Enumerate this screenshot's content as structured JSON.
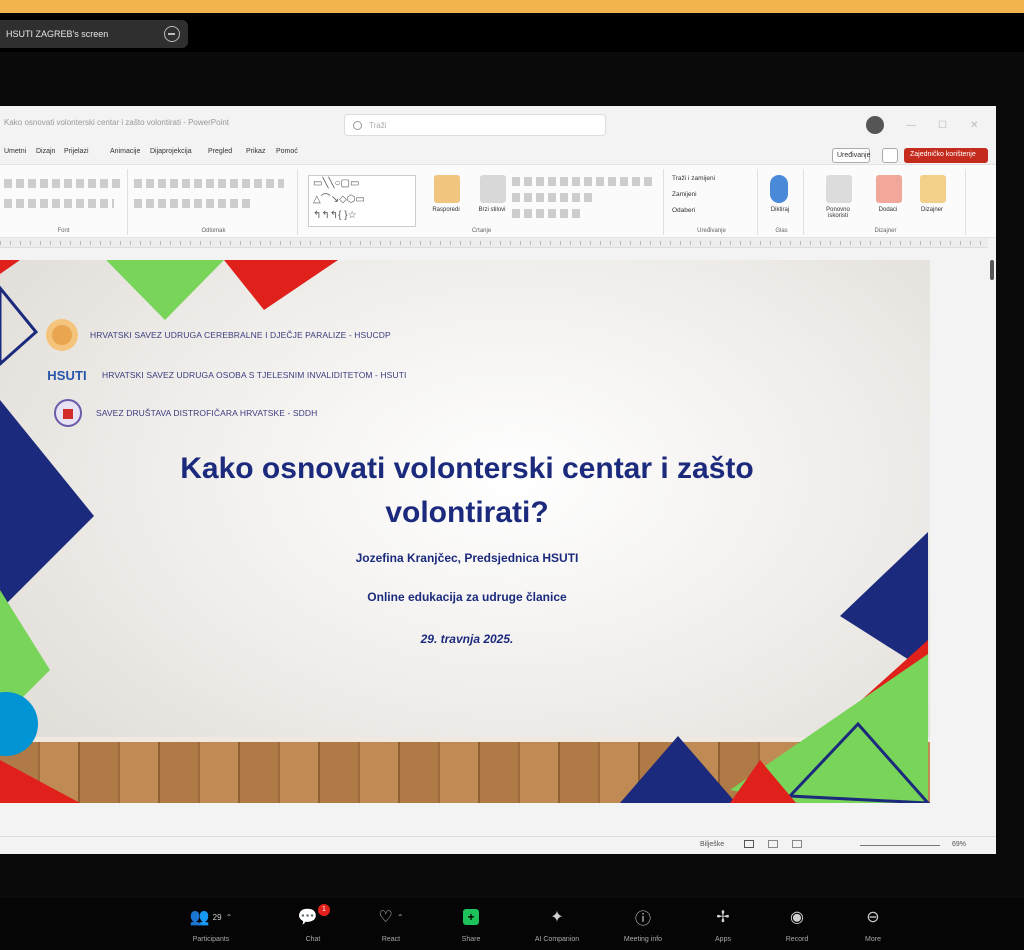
{
  "banner_color": "#f2b54d",
  "share_indicator": {
    "label": "HSUTI ZAGREB's screen",
    "icon": "minus-circle-icon"
  },
  "ppt": {
    "window_title": "Kako osnovati volonterski centar i zašto volontirati - PowerPoint",
    "search_placeholder": "Traži",
    "menu": [
      "Umetni",
      "Dizajn",
      "Prijelazi",
      "Animacije",
      "Dijaprojekcija",
      "Pregled",
      "Prikaz",
      "Pomoć"
    ],
    "editing_label": "Uređivanje",
    "share_label": "Zajedničko korištenje",
    "ribbon_groups": [
      "Font",
      "Odlomak",
      "Crtanje",
      "Uređivanje",
      "Glas",
      "Dizajner"
    ],
    "ribbon_buttons": {
      "arrange": "Rasporedi",
      "quick_styles": "Brzi stilovi",
      "find": "Traži i zamijeni",
      "replace": "Zamijeni",
      "select": "Odaberi",
      "dictate": "Diktiraj",
      "reuse": "Ponovno iskoristi",
      "addins": "Dodaci",
      "designer": "Dizajner"
    },
    "status": {
      "notes": "Bilješke",
      "zoom": "69%"
    }
  },
  "slide": {
    "orgs": [
      "HRVATSKI SAVEZ UDRUGA CEREBRALNE I DJEČJE PARALIZE - HSUCDP",
      "HRVATSKI SAVEZ UDRUGA OSOBA S TJELESNIM INVALIDITETOM - HSUTI",
      "SAVEZ DRUŠTAVA DISTROFIČARA HRVATSKE - SDDH"
    ],
    "hsuti_logo_text": "HSUTI",
    "title_line1": "Kako osnovati volonterski centar i zašto",
    "title_line2": "volontirati?",
    "presenter": "Jozefina Kranjčec, Predsjednica HSUTI",
    "event": "Online edukacija za udruge članice",
    "date": "29. travnja 2025.",
    "colors": {
      "navy": "#1b2a7c",
      "green": "#79d45a",
      "red": "#e0201b"
    }
  },
  "toolbar": {
    "participants": {
      "label": "Participants",
      "count": "29"
    },
    "chat": {
      "label": "Chat",
      "badge": "1"
    },
    "react": {
      "label": "React"
    },
    "share": {
      "label": "Share"
    },
    "ai": {
      "label": "AI Companion"
    },
    "info": {
      "label": "Meeting info"
    },
    "apps": {
      "label": "Apps"
    },
    "record": {
      "label": "Record"
    },
    "more": {
      "label": "More"
    }
  }
}
